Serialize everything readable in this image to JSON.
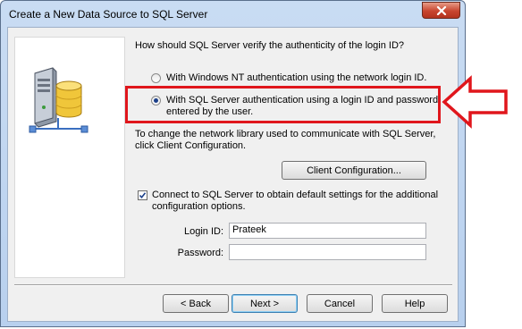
{
  "window": {
    "title": "Create a New Data Source to SQL Server",
    "close_icon": "close-icon"
  },
  "sidepanel": {
    "illustration": "database-server-icon"
  },
  "auth": {
    "question": "How should SQL Server verify the authenticity of the login ID?",
    "option_windows": "With Windows NT authentication using the network login ID.",
    "option_sql": "With SQL Server authentication using a login ID and password entered by the user.",
    "selected": "option_sql"
  },
  "network": {
    "info": "To change the network library used to communicate with SQL Server, click Client Configuration.",
    "client_config_label": "Client Configuration..."
  },
  "connect": {
    "checkbox_label": "Connect to SQL Server to obtain default settings for the additional configuration options.",
    "checked": true
  },
  "credentials": {
    "login_label": "Login ID:",
    "login_value": "Prateek",
    "password_label": "Password:",
    "password_value": ""
  },
  "footer": {
    "back_label": "< Back",
    "next_label": "Next >",
    "cancel_label": "Cancel",
    "help_label": "Help"
  },
  "annotation": {
    "highlight_color": "#e0161c",
    "arrow_icon": "left-arrow-icon"
  }
}
